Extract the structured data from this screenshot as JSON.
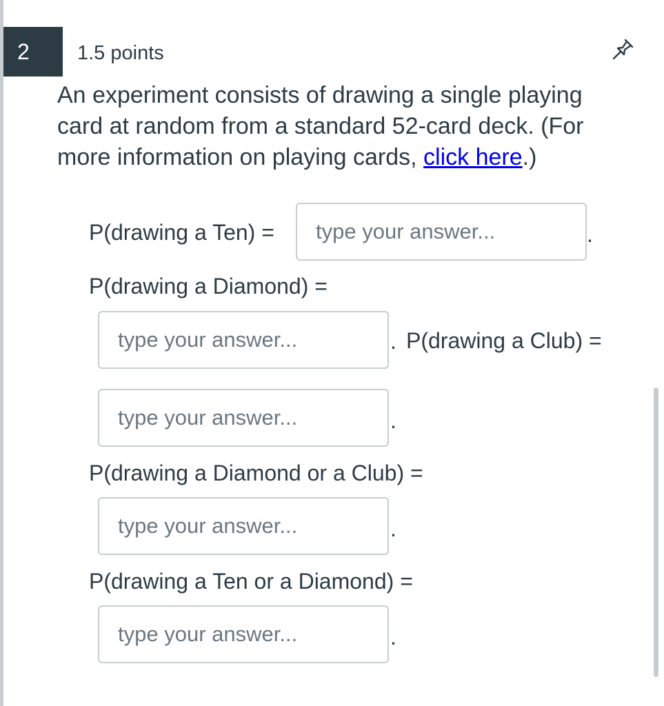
{
  "question": {
    "number": "2",
    "points": "1.5 points",
    "text_before_link": "An experiment consists of drawing a single playing card at random from a standard 52-card deck. (For more information on playing cards, ",
    "link_text": "click here",
    "text_after_link": ".)"
  },
  "prompts": {
    "ten": "P(drawing a Ten) =",
    "diamond": "P(drawing a Diamond) =",
    "club": "P(drawing a Club) =",
    "diamond_or_club": "P(drawing a Diamond or a Club) =",
    "ten_or_diamond": "P(drawing a Ten or a Diamond) ="
  },
  "answers": {
    "placeholder": "type your answer...",
    "period": "."
  },
  "icons": {
    "pin": "pin-icon"
  },
  "colors": {
    "badge_bg": "#2d3b45",
    "text": "#2d3b45",
    "link": "#0000ee",
    "border": "#c7cdd1"
  }
}
